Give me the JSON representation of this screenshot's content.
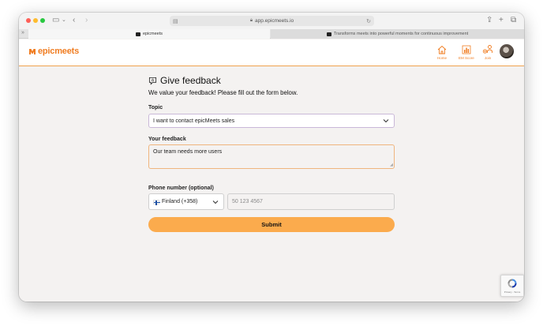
{
  "browser": {
    "address": "app.epicmeets.io",
    "tabs": [
      {
        "label": "epicmeets"
      },
      {
        "label": "Transforms meets into powerful moments for continuous improvement"
      }
    ]
  },
  "header": {
    "logo_text": "epicmeets",
    "nav": [
      {
        "label": "Home",
        "icon": "home-icon"
      },
      {
        "label": "EM Score",
        "icon": "bar-chart-icon"
      },
      {
        "label": "Join",
        "icon": "join-icon"
      }
    ],
    "brand_color": "#f07d22"
  },
  "form": {
    "title": "Give feedback",
    "subtitle": "We value your feedback! Please fill out the form below.",
    "topic_label": "Topic",
    "topic_value": "I want to contact epicMeets sales",
    "feedback_label": "Your feedback",
    "feedback_value": "Our team needs more users",
    "phone_label": "Phone number (optional)",
    "country_value": "Finland (+358)",
    "phone_placeholder": "50 123 4567",
    "submit_label": "Submit",
    "submit_color": "#fbab4d"
  },
  "recaptcha": {
    "links": "Privacy - Terms"
  }
}
